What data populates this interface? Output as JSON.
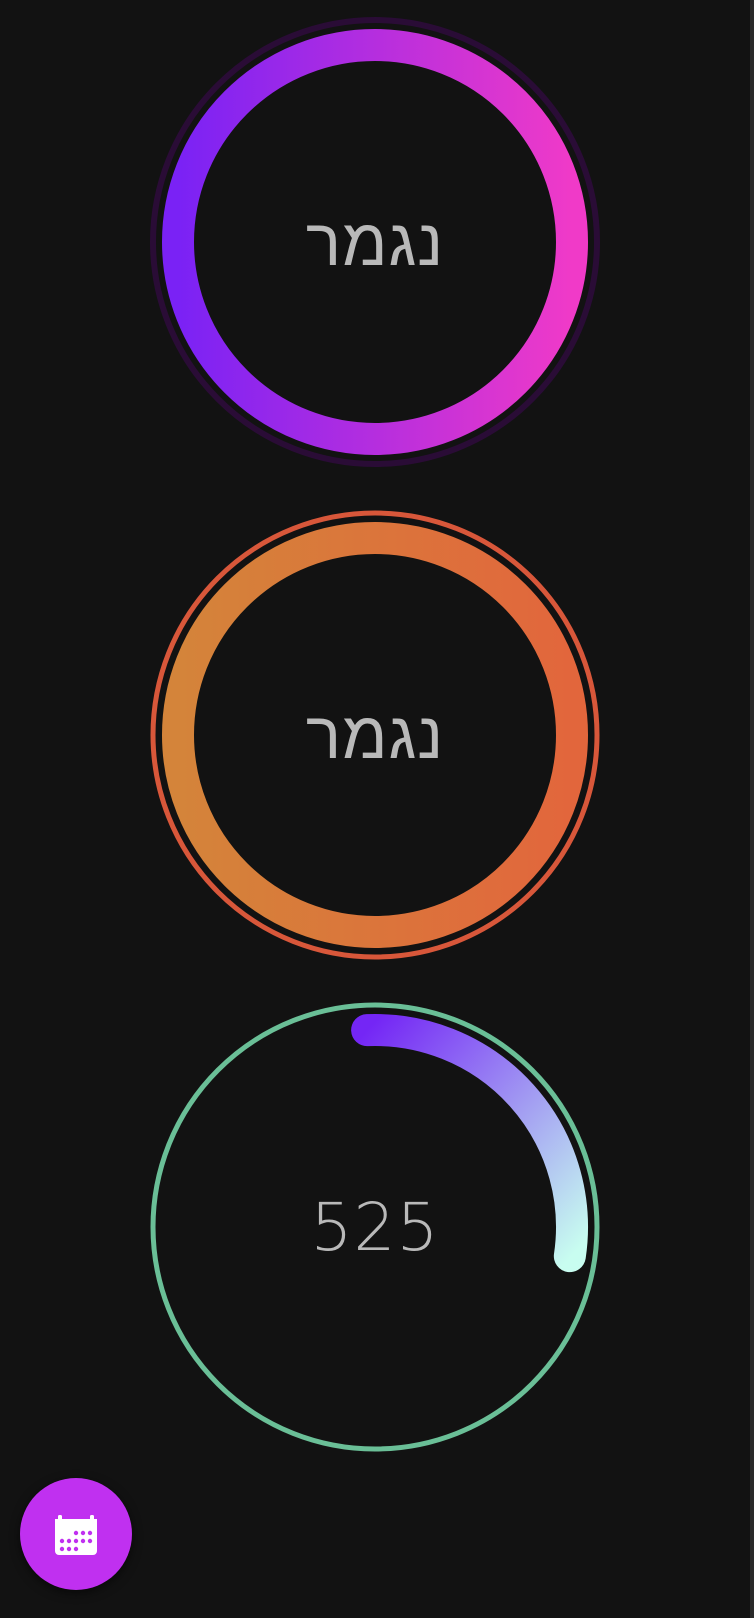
{
  "rings": [
    {
      "label": "נגמר",
      "progress": 1.0,
      "outline_color": "#2a0c36",
      "gradient": [
        "#7a22f5",
        "#f03ac8"
      ]
    },
    {
      "label": "נגמר",
      "progress": 1.0,
      "outline_color": "#d8573a",
      "gradient": [
        "#d4843a",
        "#e2663c"
      ]
    },
    {
      "label": "525",
      "progress": 0.28,
      "outline_color": "#6abf97",
      "gradient": [
        "#7426f5",
        "#c8fdf0"
      ]
    }
  ],
  "fab": {
    "icon": "calendar-icon",
    "color": "#c030f0"
  }
}
